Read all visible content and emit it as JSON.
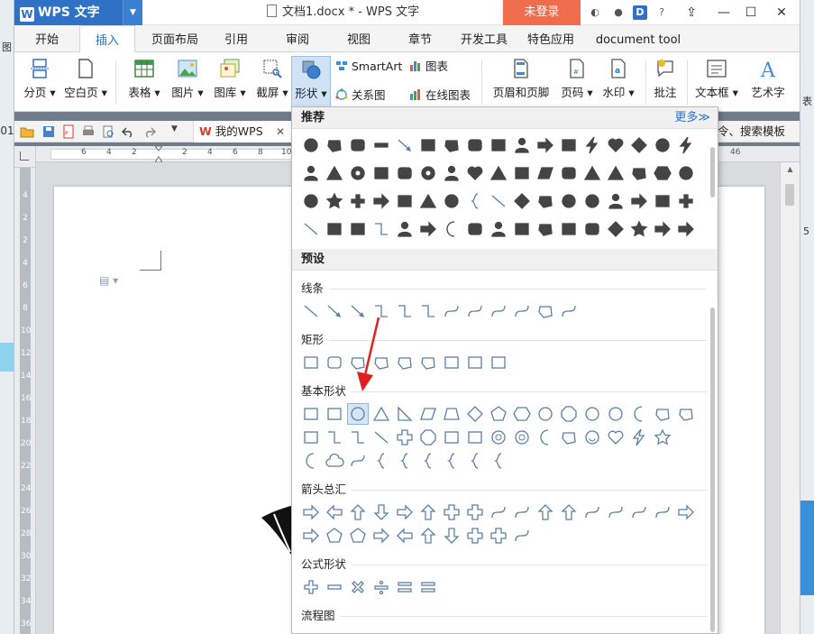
{
  "titlebar": {
    "app_name": "WPS 文字",
    "doc_title": "文档1.docx * - WPS 文字",
    "login_label": "未登录"
  },
  "tabs": [
    "开始",
    "插入",
    "页面布局",
    "引用",
    "审阅",
    "视图",
    "章节",
    "开发工具",
    "特色应用",
    "document tool"
  ],
  "active_tab": "插入",
  "ribbon": {
    "page_break": "分页",
    "blank_page": "空白页",
    "table": "表格",
    "picture": "图片",
    "gallery": "图库",
    "screenshot": "截屏",
    "shapes": "形状",
    "smartart": "SmartArt",
    "chart": "图表",
    "relation_chart": "关系图",
    "online_chart": "在线图表",
    "header_footer": "页眉和页脚",
    "page_number": "页码",
    "watermark": "水印",
    "comment": "批注",
    "textbox": "文本框",
    "wordart": "艺术字",
    "cut_right": "表"
  },
  "quickbar": {
    "mywps": "我的WPS",
    "close": "✕",
    "search_template": "令、搜索模板"
  },
  "left_strip": {
    "row_num": "01",
    "partial_label": "图"
  },
  "hruler_numbers": [
    "6",
    "4",
    "2",
    "2",
    "4",
    "6",
    "8",
    "10",
    "46"
  ],
  "vruler_numbers": [
    "4",
    "2",
    "2",
    "4",
    "6",
    "8",
    "10",
    "12",
    "14",
    "16",
    "18",
    "20",
    "22",
    "24",
    "26",
    "28",
    "30",
    "32",
    "34",
    "36",
    "38"
  ],
  "right_strip": {
    "num": "5"
  },
  "shapes_panel": {
    "recommended": "推荐",
    "more": "更多≫",
    "presets": "预设",
    "lines": "线条",
    "rectangles": "矩形",
    "basic_shapes": "基本形状",
    "arrows": "箭头总汇",
    "formula_shapes": "公式形状",
    "flowchart": "流程图"
  },
  "colors": {
    "wps_blue": "#2f72c5",
    "login_orange": "#ef6c4c",
    "shape_outline": "#5a7fa8",
    "annotation_red": "#e02020"
  }
}
